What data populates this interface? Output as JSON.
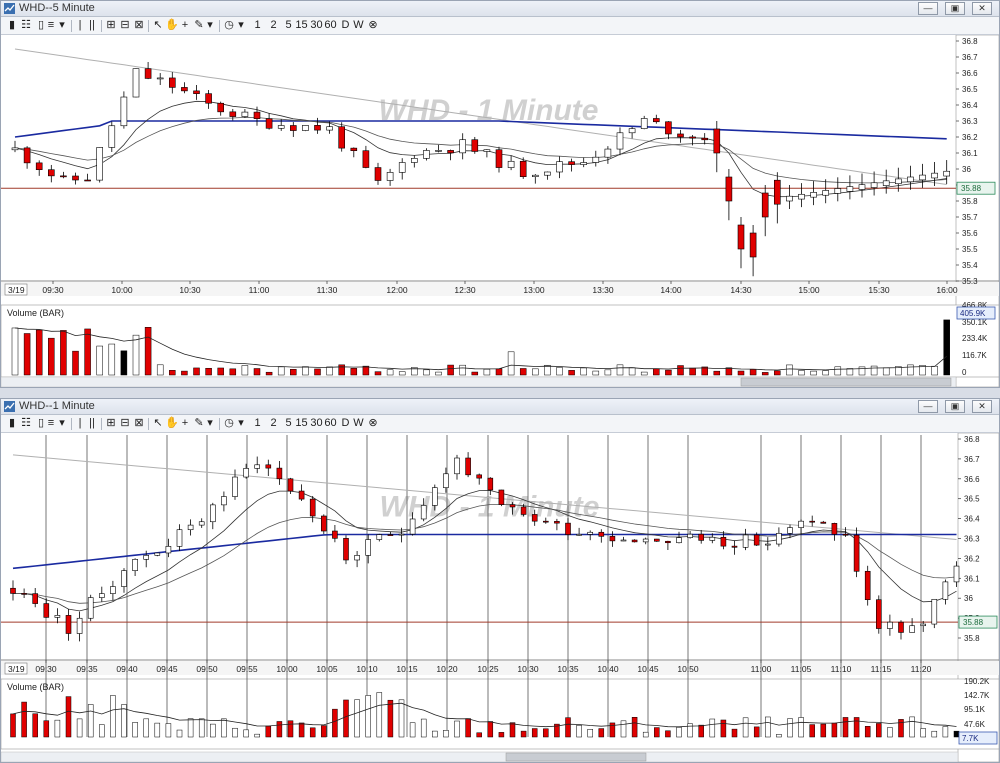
{
  "top_window": {
    "title": "WHD--5 Minute",
    "watermark": "WHD - 1 Minute",
    "date_label": "3/19",
    "toolbar": {
      "periods": [
        "1",
        "2",
        "5",
        "15",
        "30",
        "60",
        "D",
        "W"
      ]
    },
    "price_ticks": [
      "36.8",
      "36.7",
      "36.6",
      "36.5",
      "36.4",
      "36.3",
      "36.2",
      "36.1",
      "36",
      "35.9",
      "35.8",
      "35.7",
      "35.6",
      "35.5",
      "35.4",
      "35.3"
    ],
    "last_price": "35.88",
    "time_labels": [
      "09:30",
      "10:00",
      "10:30",
      "11:00",
      "11:30",
      "12:00",
      "12:30",
      "13:00",
      "13:30",
      "14:00",
      "14:30",
      "15:00",
      "15:30",
      "16:00"
    ],
    "volume_title": "Volume (BAR)",
    "volume_ticks": [
      "466.8K",
      "350.1K",
      "233.4K",
      "116.7K",
      "0"
    ],
    "last_volume": "405.9K"
  },
  "bottom_window": {
    "title": "WHD--1 Minute",
    "watermark": "WHD - 1 Minute",
    "date_label": "3/19",
    "toolbar": {
      "periods": [
        "1",
        "2",
        "5",
        "15",
        "30",
        "60",
        "D",
        "W"
      ]
    },
    "price_ticks": [
      "36.8",
      "36.7",
      "36.6",
      "36.5",
      "36.4",
      "36.3",
      "36.2",
      "36.1",
      "36",
      "35.9",
      "35.8"
    ],
    "last_price": "35.88",
    "time_labels": [
      "09:30",
      "09:35",
      "09:40",
      "09:45",
      "09:50",
      "09:55",
      "10:00",
      "10:05",
      "10:10",
      "10:15",
      "10:20",
      "10:25",
      "10:30",
      "10:35",
      "10:40",
      "10:45",
      "10:50",
      "11:00",
      "11:05",
      "11:10",
      "11:15",
      "11:20"
    ],
    "volume_title": "Volume (BAR)",
    "volume_ticks": [
      "190.2K",
      "142.7K",
      "95.1K",
      "47.6K"
    ],
    "last_volume": "7.7K"
  },
  "colors": {
    "up": "#ffffff",
    "down": "#e00000",
    "ma_blue": "#1a2aa0",
    "ref_line": "#a03a2a",
    "ma_black": "#111111",
    "ma_gray": "#b0b0b0"
  }
}
